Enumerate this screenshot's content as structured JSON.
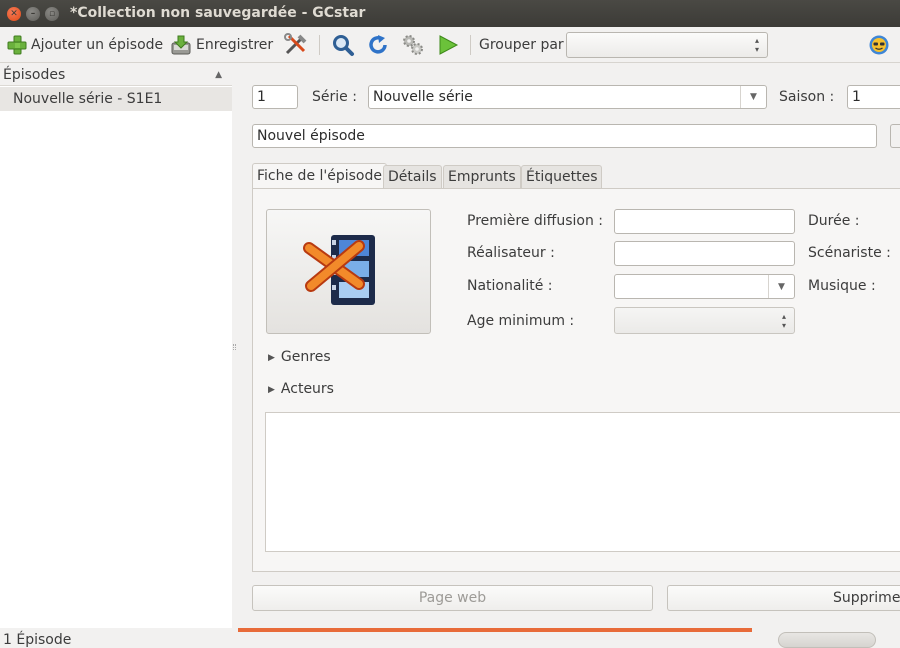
{
  "window": {
    "title": "*Collection non sauvegardée - GCstar"
  },
  "toolbar": {
    "add_label": "Ajouter un épisode",
    "save_label": "Enregistrer",
    "group_by_label": "Grouper par",
    "group_by_value": ""
  },
  "list": {
    "header": "Épisodes",
    "items": [
      {
        "label": "Nouvelle série - S1E1"
      }
    ]
  },
  "episode": {
    "number": "1",
    "serie_label": "Série :",
    "serie_value": "Nouvelle série",
    "saison_label": "Saison :",
    "saison_value": "1",
    "title_value": "Nouvel épisode"
  },
  "tabs": [
    {
      "label": "Fiche de l'épisode",
      "active": true
    },
    {
      "label": "Détails",
      "active": false
    },
    {
      "label": "Emprunts",
      "active": false
    },
    {
      "label": "Étiquettes",
      "active": false
    }
  ],
  "form": {
    "premiere_label": "Première diffusion :",
    "premiere_value": "",
    "duree_label": "Durée :",
    "realisateur_label": "Réalisateur :",
    "realisateur_value": "",
    "scenariste_label": "Scénariste :",
    "nationalite_label": "Nationalité :",
    "nationalite_value": "",
    "musique_label": "Musique :",
    "age_label": "Age minimum :",
    "age_value": ""
  },
  "expanders": {
    "genres": "Genres",
    "acteurs": "Acteurs"
  },
  "buttons": {
    "web_page": "Page web",
    "delete": "Supprimer"
  },
  "status": {
    "count_text": "1 Épisode"
  },
  "colors": {
    "titlebar": "#3c3b37",
    "close_button": "#df4a16",
    "progress": "#e86b3a",
    "selection": "#e8e6e3"
  }
}
